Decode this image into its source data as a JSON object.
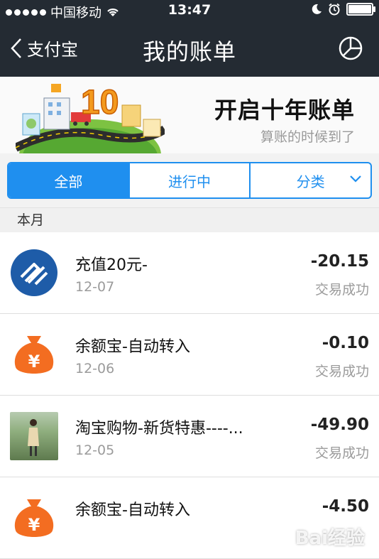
{
  "status_bar": {
    "carrier": "中国移动",
    "time": "13:47"
  },
  "navbar": {
    "back_label": "支付宝",
    "title": "我的账单"
  },
  "banner": {
    "badge_number": "10",
    "title": "开启十年账单",
    "subtitle": "算账的时候到了"
  },
  "tabs": [
    {
      "label": "全部",
      "active": true
    },
    {
      "label": "进行中",
      "active": false
    },
    {
      "label": "分类",
      "active": false
    }
  ],
  "section": {
    "label": "本月"
  },
  "transactions": [
    {
      "title": "充值20元-",
      "date": "12-07",
      "amount": "-20.15",
      "status": "交易成功",
      "icon": "china-mobile-icon"
    },
    {
      "title": "余额宝-自动转入",
      "date": "12-06",
      "amount": "-0.10",
      "status": "交易成功",
      "icon": "yuebao-money-bag-icon"
    },
    {
      "title": "淘宝购物-新货特惠----...",
      "date": "12-05",
      "amount": "-49.90",
      "status": "交易成功",
      "icon": "merchant-photo"
    },
    {
      "title": "余额宝-自动转入",
      "date": "",
      "amount": "-4.50",
      "status": "",
      "icon": "yuebao-money-bag-icon"
    }
  ],
  "watermark": "Bai经验",
  "colors": {
    "header_bg": "#242b33",
    "accent_blue": "#1f8fef",
    "money_bag_orange": "#f36d21",
    "china_mobile_blue": "#1e5ca8"
  }
}
